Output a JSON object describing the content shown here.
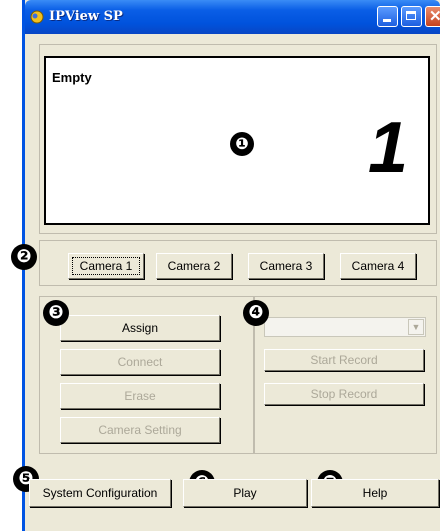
{
  "window": {
    "title": "IPView SP"
  },
  "video": {
    "status": "Empty",
    "number": "1"
  },
  "callouts": [
    "❶",
    "❷",
    "❸",
    "❹",
    "❺",
    "❻",
    "❼"
  ],
  "cameras": [
    "Camera 1",
    "Camera 2",
    "Camera 3",
    "Camera 4"
  ],
  "left_panel": {
    "assign": "Assign",
    "connect": "Connect",
    "erase": "Erase",
    "camera_setting": "Camera Setting"
  },
  "right_panel": {
    "dropdown_value": "",
    "start_record": "Start Record",
    "stop_record": "Stop Record"
  },
  "bottom": {
    "system_configuration": "System Configuration",
    "play": "Play",
    "help": "Help"
  },
  "colors": {
    "titlebar": "#0a5ee6",
    "window_bg": "#ece9d8",
    "disabled_text": "#aca899"
  }
}
